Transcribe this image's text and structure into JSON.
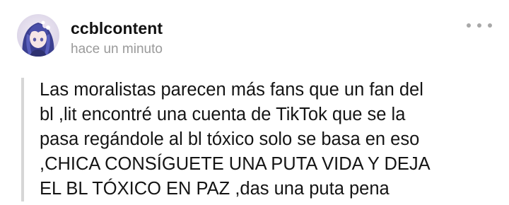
{
  "post": {
    "username": "ccblcontent",
    "timestamp": "hace un minuto",
    "more_icon": "more-horizontal-icon",
    "avatar_icon": "avatar-anime-character-icon",
    "quote": {
      "text": "Las moralistas parecen más fans que un fan del\nbl ,lit encontré una cuenta de TikTok que se la\npasa regándole al bl tóxico solo se basa en eso\n,CHICA CONSÍGUETE UNA PUTA VIDA Y DEJA\nEL BL TÓXICO EN PAZ ,das una puta pena"
    }
  },
  "colors": {
    "username": "#111111",
    "timestamp": "#9a9a9a",
    "quote_border": "#d6d6d6",
    "more_dots": "#a8a8a8",
    "body_text": "#141414"
  }
}
